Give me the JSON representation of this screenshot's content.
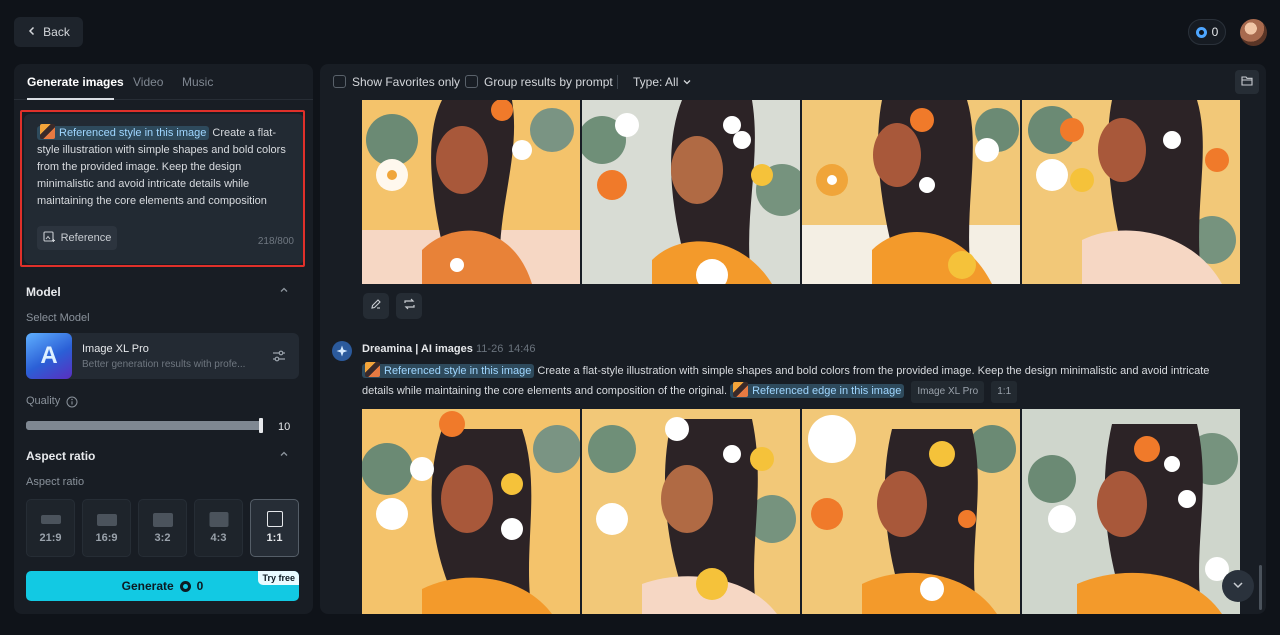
{
  "topbar": {
    "back_label": "Back",
    "credits": "0"
  },
  "left_panel": {
    "tabs": [
      {
        "label": "Generate images",
        "active": true
      },
      {
        "label": "Video",
        "active": false
      },
      {
        "label": "Music",
        "active": false
      }
    ],
    "prompt": {
      "ref_chip": "Referenced style in this image",
      "text": "Create a flat-style illustration with simple shapes and bold colors from the provided image. Keep the design minimalistic and avoid intricate details while maintaining the core elements and composition",
      "reference_button": "Reference",
      "counter": "218/800"
    },
    "model_section": {
      "title": "Model",
      "select_label": "Select Model",
      "model_name": "Image XL Pro",
      "model_desc": "Better generation results with profe...",
      "model_glyph": "A"
    },
    "quality": {
      "label": "Quality",
      "value": "10",
      "level": 1.0
    },
    "aspect_section": {
      "title": "Aspect ratio",
      "sub_label": "Aspect ratio",
      "options": [
        {
          "label": "21:9",
          "active": false
        },
        {
          "label": "16:9",
          "active": false
        },
        {
          "label": "3:2",
          "active": false
        },
        {
          "label": "4:3",
          "active": false
        },
        {
          "label": "1:1",
          "active": true
        }
      ]
    },
    "generate": {
      "label": "Generate",
      "credits": "0",
      "badge": "Try free"
    }
  },
  "right_panel": {
    "filters": {
      "favorites_label": "Show Favorites only",
      "group_label": "Group results by prompt",
      "type_label": "Type: All"
    },
    "second_group": {
      "title": "Dreamina | AI images",
      "date": "11-26",
      "time": "14:46",
      "style_chip": "Referenced style in this image",
      "prompt": "Create a flat-style illustration with simple shapes and bold colors from the provided image. Keep the design minimalistic and avoid intricate details while maintaining the core elements and composition of the original.",
      "edge_chip": "Referenced edge in this image",
      "model_tag": "Image XL Pro",
      "ratio_tag": "1:1"
    }
  },
  "colors": {
    "accent": "#12c9e3",
    "highlight_border": "#e0302a",
    "chip_text": "#9fd6ff"
  },
  "icons": [
    "chevron-left-icon",
    "coin-icon",
    "image-reference-icon",
    "info-icon",
    "sliders-icon",
    "chevron-up-icon",
    "chevron-down-icon",
    "folder-icon",
    "pencil-icon",
    "regenerate-icon",
    "dreamina-logo-icon"
  ]
}
